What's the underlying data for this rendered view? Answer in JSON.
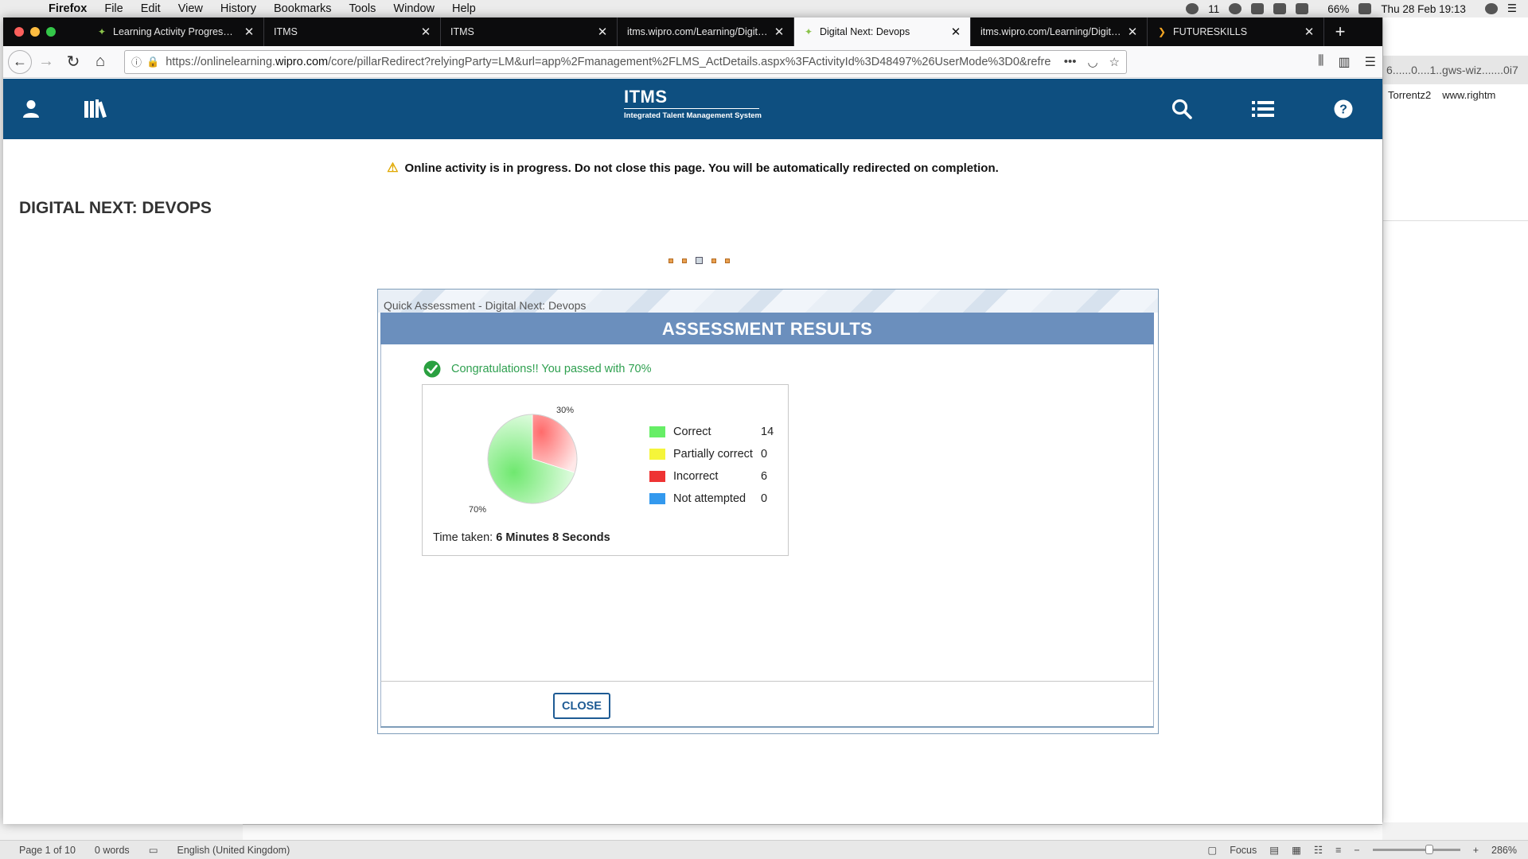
{
  "menubar": {
    "app_name": "Firefox",
    "items": [
      "File",
      "Edit",
      "View",
      "History",
      "Bookmarks",
      "Tools",
      "Window",
      "Help"
    ],
    "badge_count": "11",
    "battery": "66%",
    "datetime": "Thu 28 Feb  19:13"
  },
  "tabs": [
    {
      "title": "Learning Activity Progress Details",
      "active": false
    },
    {
      "title": "ITMS",
      "active": false
    },
    {
      "title": "ITMS",
      "active": false
    },
    {
      "title": "itms.wipro.com/Learning/Digitalnext",
      "active": false
    },
    {
      "title": "Digital Next: Devops",
      "active": true
    },
    {
      "title": "itms.wipro.com/Learning/Digitalnext",
      "active": false
    },
    {
      "title": "FUTURESKILLS",
      "active": false
    }
  ],
  "urlbar": {
    "url_prefix": "https://onlinelearning.",
    "url_domain": "wipro.com",
    "url_rest": "/core/pillarRedirect?relyingParty=LM&url=app%2Fmanagement%2FLMS_ActDetails.aspx%3FActivityId%3D48497%26UserMode%3D0&refre"
  },
  "background_app": {
    "url_fragment": "6......0....1..gws-wiz.......0i7",
    "bookmarks": [
      "Torrentz2",
      "www.rightm"
    ]
  },
  "header": {
    "logo_title": "ITMS",
    "logo_subtitle": "Integrated Talent Management System"
  },
  "warning": {
    "text": "Online activity is in progress. Do not close this page. You will be automatically redirected on completion."
  },
  "activity": {
    "title": "DIGITAL NEXT: DEVOPS"
  },
  "modal": {
    "window_title": "Quick Assessment - Digital Next: Devops",
    "header": "ASSESSMENT RESULTS",
    "pass_message": "Congratulations!! You passed with 70%",
    "time_label": "Time taken: ",
    "time_value": "6 Minutes 8 Seconds",
    "close_label": "CLOSE"
  },
  "chart_data": {
    "type": "pie",
    "slices": [
      {
        "label": "Correct",
        "value": 14,
        "percent_label": "70%",
        "color": "#66ee66"
      },
      {
        "label": "Incorrect",
        "value": 6,
        "percent_label": "30%",
        "color": "#ff4444"
      }
    ],
    "legend": [
      {
        "label": "Correct",
        "value": "14",
        "color": "#66ee66"
      },
      {
        "label": "Partially correct",
        "value": "0",
        "color": "#f5f53a"
      },
      {
        "label": "Incorrect",
        "value": "6",
        "color": "#ee3333"
      },
      {
        "label": "Not attempted",
        "value": "0",
        "color": "#3399ee"
      }
    ]
  },
  "word_status": {
    "page": "Page 1 of 10",
    "words": "0 words",
    "language": "English (United Kingdom)",
    "focus": "Focus",
    "zoom": "286%"
  }
}
